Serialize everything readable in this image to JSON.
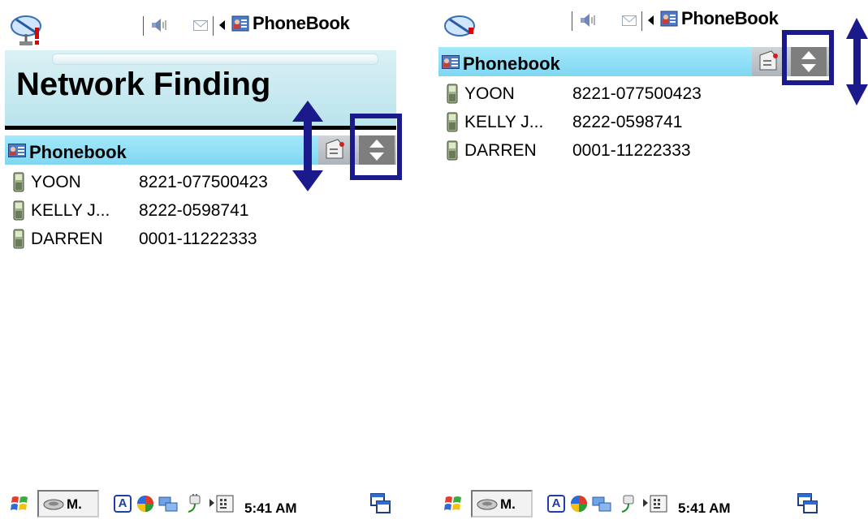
{
  "colors": {
    "annotation": "#1a1a8c",
    "header_band": "#b9e3ec",
    "phonebook_bar": "#7fd7f1",
    "scroll_button": "#7e7e7e"
  },
  "topbar": {
    "app_title": "PhoneBook",
    "icons": [
      "satellite-dish-icon",
      "speaker-icon",
      "mail-icon",
      "tab-left-arrow-icon",
      "phonebook-app-icon"
    ]
  },
  "left_screen": {
    "header_title": "Network Finding",
    "phonebook_label": "Phonebook"
  },
  "right_screen": {
    "phonebook_label": "Phonebook"
  },
  "contacts": [
    {
      "name": "YOON",
      "number": "8221-077500423"
    },
    {
      "name": "KELLY J...",
      "number": "8222-0598741"
    },
    {
      "name": "DARREN",
      "number": "0001-11222333"
    }
  ],
  "taskbar": {
    "start_icon": "windows-flag-icon",
    "app_button": "M.",
    "input_icon": "A",
    "time": "5:41 AM"
  }
}
